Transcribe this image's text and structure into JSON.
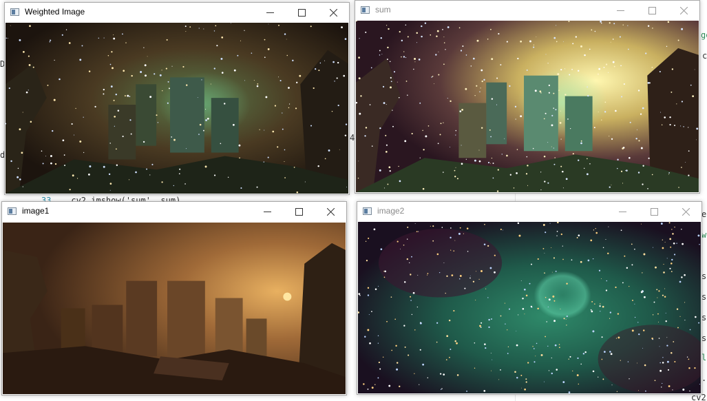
{
  "editor": {
    "visible_code": "cv2.imshow('sum', sum)",
    "line_number": "33",
    "right_fragments": [
      "ge",
      "c",
      "e",
      "w",
      "s",
      "s",
      "s",
      "s",
      "l",
      ".",
      "cv2"
    ],
    "left_fragments": [
      "De",
      "da"
    ],
    "mid_fragment": "4"
  },
  "windows": [
    {
      "title": "Weighted Image",
      "active": true
    },
    {
      "title": "sum",
      "active": false
    },
    {
      "title": "image1",
      "active": true
    },
    {
      "title": "image2",
      "active": false
    }
  ],
  "controls": {
    "minimize": "minimize-icon",
    "maximize": "maximize-icon",
    "close": "close-icon"
  },
  "colors": {
    "nebula_green": "#2f8a6a",
    "ruins_orange": "#b0703a",
    "space_dark": "#1a1020"
  }
}
